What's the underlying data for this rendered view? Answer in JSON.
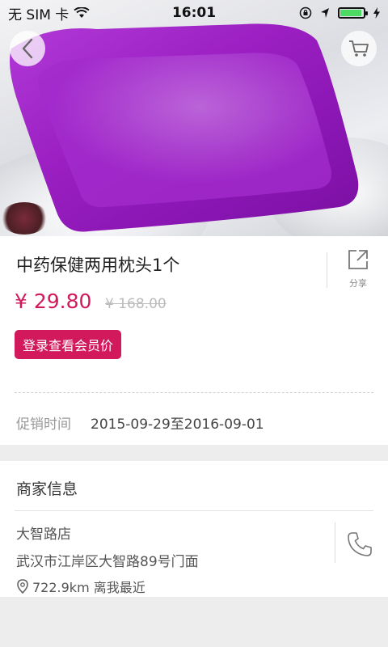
{
  "status_bar": {
    "carrier": "无 SIM 卡",
    "time": "16:01"
  },
  "product": {
    "title": "中药保健两用枕头1个",
    "price": "¥ 29.80",
    "original_price": "¥ 168.00",
    "member_button": "登录查看会员价",
    "share_label": "分享",
    "promo_label": "促销时间",
    "promo_value": "2015-09-29至2016-09-01"
  },
  "merchant": {
    "section_title": "商家信息",
    "store_name": "大智路店",
    "address": "武汉市江岸区大智路89号门面",
    "distance": "722.9km 离我最近"
  },
  "colors": {
    "accent": "#d2195b",
    "pillow": "#9b1fc2",
    "battery": "#4cd964"
  },
  "icons": [
    "back-arrow-icon",
    "cart-icon",
    "share-icon",
    "location-pin-icon",
    "phone-icon",
    "wifi-icon",
    "lock-rotation-icon",
    "location-arrow-icon",
    "battery-icon",
    "charging-icon"
  ]
}
